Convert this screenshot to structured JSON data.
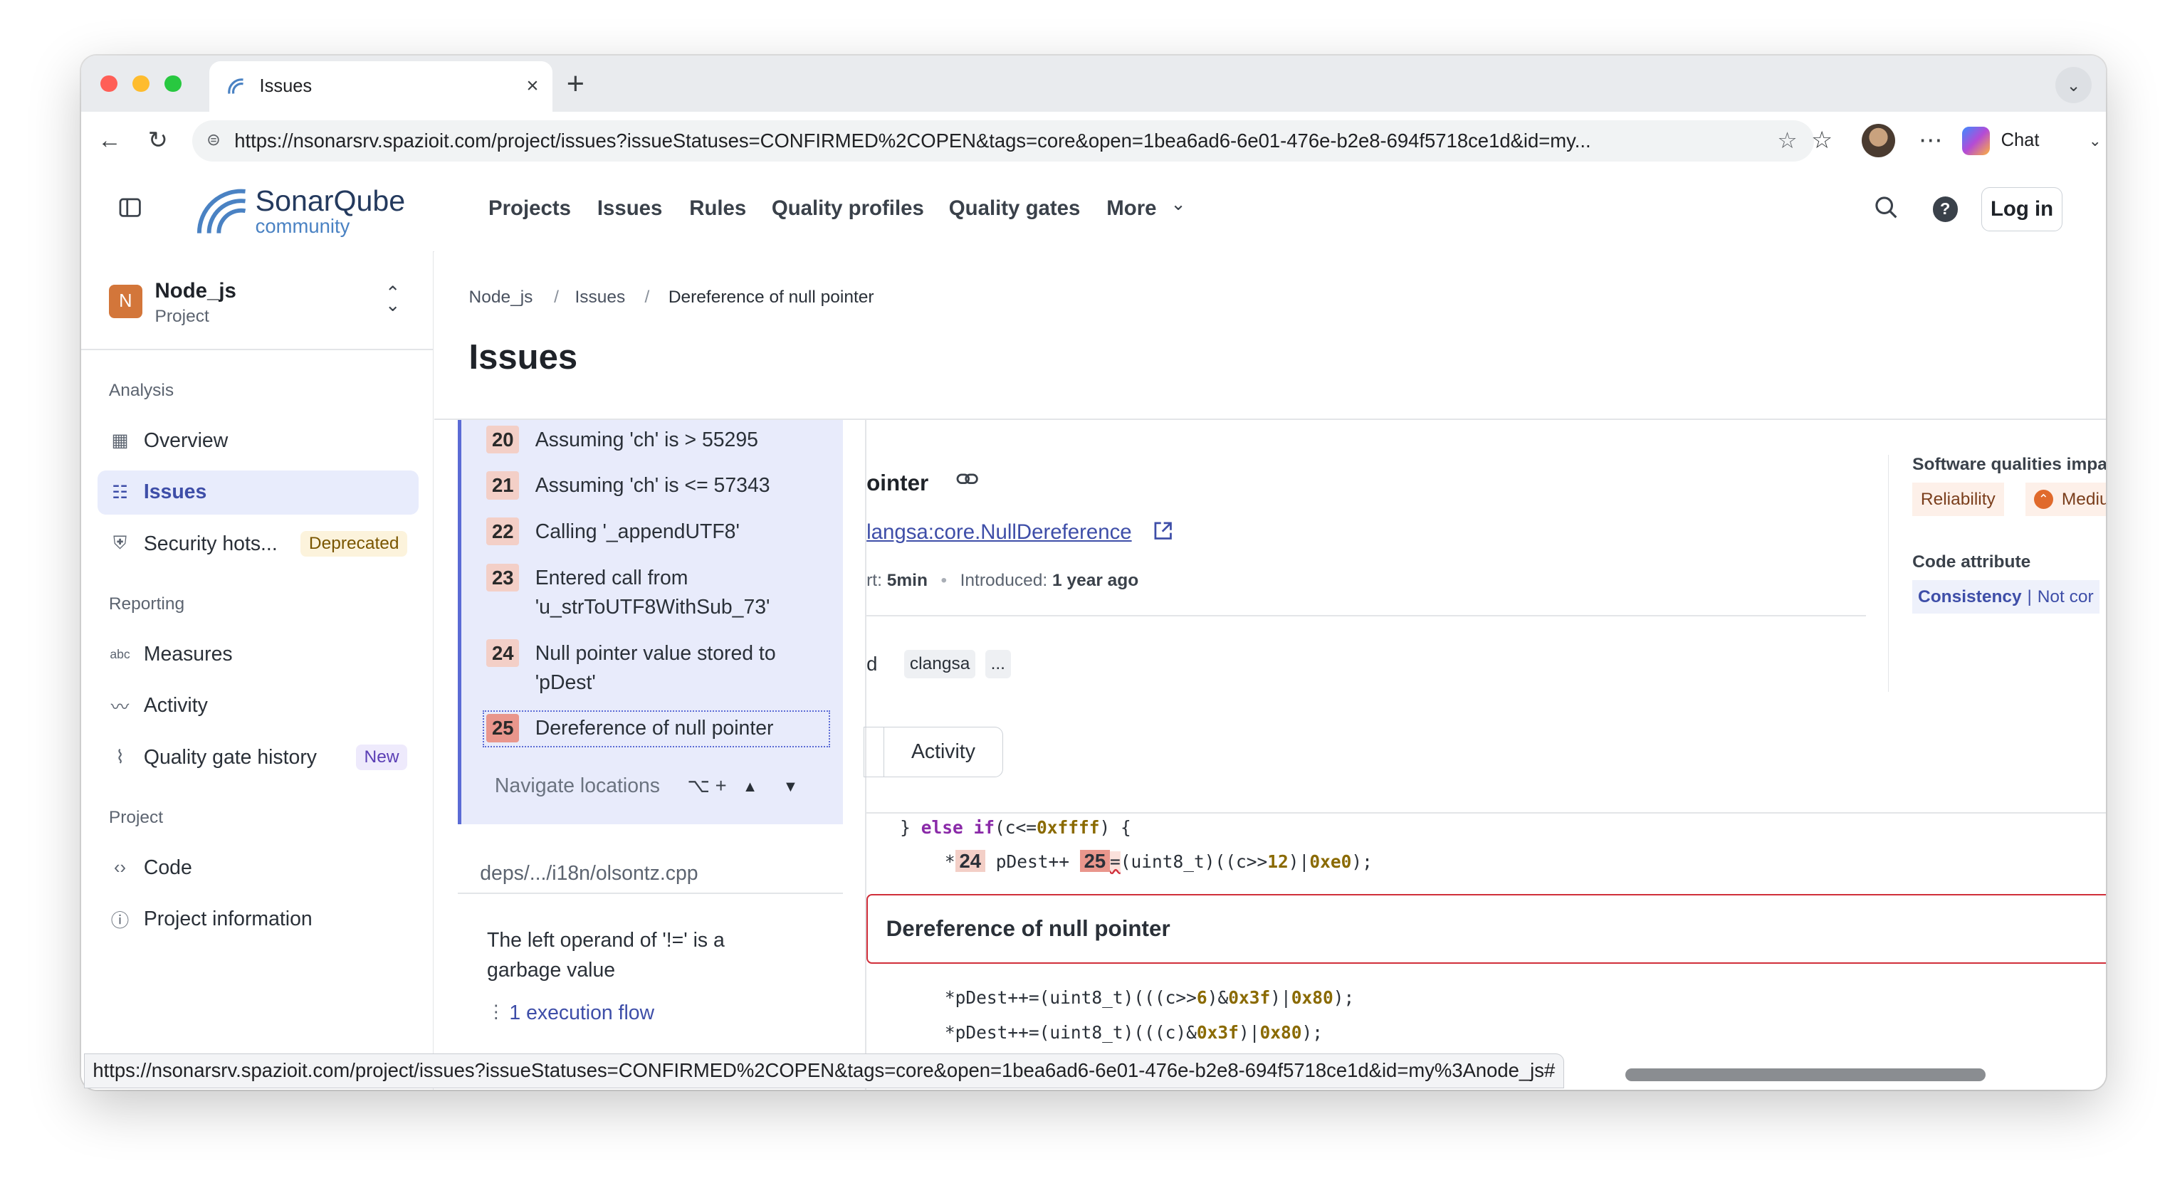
{
  "browser": {
    "tab_title": "Issues",
    "close_glyph": "×",
    "new_tab_glyph": "+",
    "url": "https://nsonarsrv.spazioit.com/project/issues?issueStatuses=CONFIRMED%2COPEN&tags=core&open=1bea6ad6-6e01-476e-b2e8-694f5718ce1d&id=my...",
    "chat_label": "Chat",
    "status_url": "https://nsonarsrv.spazioit.com/project/issues?issueStatuses=CONFIRMED%2COPEN&tags=core&open=1bea6ad6-6e01-476e-b2e8-694f5718ce1d&id=my%3Anode_js#",
    "traffic_light_colors": [
      "#ff5f57",
      "#febc2e",
      "#28c840"
    ]
  },
  "brand": {
    "name": "SonarQube",
    "edition": "community"
  },
  "nav": {
    "items": [
      "Projects",
      "Issues",
      "Rules",
      "Quality profiles",
      "Quality gates",
      "More"
    ],
    "login": "Log in"
  },
  "project": {
    "initial": "N",
    "name": "Node_js",
    "kind": "Project"
  },
  "sidebar": {
    "analysis_label": "Analysis",
    "overview": "Overview",
    "issues": "Issues",
    "security": "Security hots...",
    "security_badge": "Deprecated",
    "reporting_label": "Reporting",
    "measures": "Measures",
    "activity": "Activity",
    "qg_history": "Quality gate history",
    "qg_badge": "New",
    "project_label": "Project",
    "code": "Code",
    "project_info": "Project information"
  },
  "breadcrumb": {
    "project": "Node_js",
    "sep": "/",
    "issues": "Issues",
    "current": "Dereference of null pointer"
  },
  "page": {
    "title": "Issues"
  },
  "flow": {
    "steps": [
      {
        "num": "20",
        "text": "Assuming 'ch' is > 55295"
      },
      {
        "num": "21",
        "text": "Assuming 'ch' is <= 57343"
      },
      {
        "num": "22",
        "text": "Calling '_appendUTF8'"
      },
      {
        "num": "23",
        "text": "Entered call from 'u_strToUTF8WithSub_73'"
      },
      {
        "num": "24",
        "text": "Null pointer value stored to 'pDest'"
      },
      {
        "num": "25",
        "text": "Dereference of null pointer"
      }
    ],
    "navigate_label": "Navigate locations",
    "shortcut": "⌥ +"
  },
  "issue_list": {
    "file_path": "deps/.../i18n/olsontz.cpp",
    "message": "The left operand of '!=' is a garbage value",
    "exec_flow": "1 execution flow"
  },
  "detail": {
    "title_fragment": "ointer",
    "rule_link": "langsa:core.NullDereference",
    "effort_label": "rt:",
    "effort_value": "5min",
    "introduced_label": "Introduced:",
    "introduced_value": "1 year ago",
    "tag_prefix": "d",
    "tag": "clangsa",
    "tag_more": "...",
    "tab_activity": "Activity"
  },
  "qualities": {
    "label": "Software qualities impa",
    "reliability": "Reliability",
    "severity": "Mediu",
    "attr_label": "Code attribute",
    "attr_value": "Consistency",
    "attr_sep": "|",
    "attr_extra": "Not cor"
  },
  "code": {
    "line1_pre": "} ",
    "line1_kw1": "else",
    "line1_kw2": "if",
    "line1_mid": "(c<=",
    "line1_num": "0xffff",
    "line1_end": ") {",
    "line2_star": "*",
    "line2_n24": "24",
    "line2_a": " pDest++ ",
    "line2_n25": "25",
    "line2_eq": "=",
    "line2_b": "(uint8_t)((c>>",
    "line2_n12": "12",
    "line2_c": ")|",
    "line2_hex": "0xe0",
    "line2_d": ");",
    "issue_box": "Dereference of null pointer",
    "line3_a": "*pDest++=(uint8_t)(((c>>",
    "line3_n6": "6",
    "line3_b": ")&",
    "line3_h1": "0x3f",
    "line3_c": ")|",
    "line3_h2": "0x80",
    "line3_d": ");",
    "line4_a": "*pDest++=(uint8_t)(((c)&",
    "line4_h1": "0x3f",
    "line4_b": ")|",
    "line4_h2": "0x80",
    "line4_c": ");"
  },
  "icons": [
    "sidebar-toggle-icon",
    "search-icon",
    "help-icon",
    "link-icon",
    "external-link-icon",
    "chevron-down-icon",
    "back-icon",
    "reload-icon",
    "star-icon"
  ]
}
